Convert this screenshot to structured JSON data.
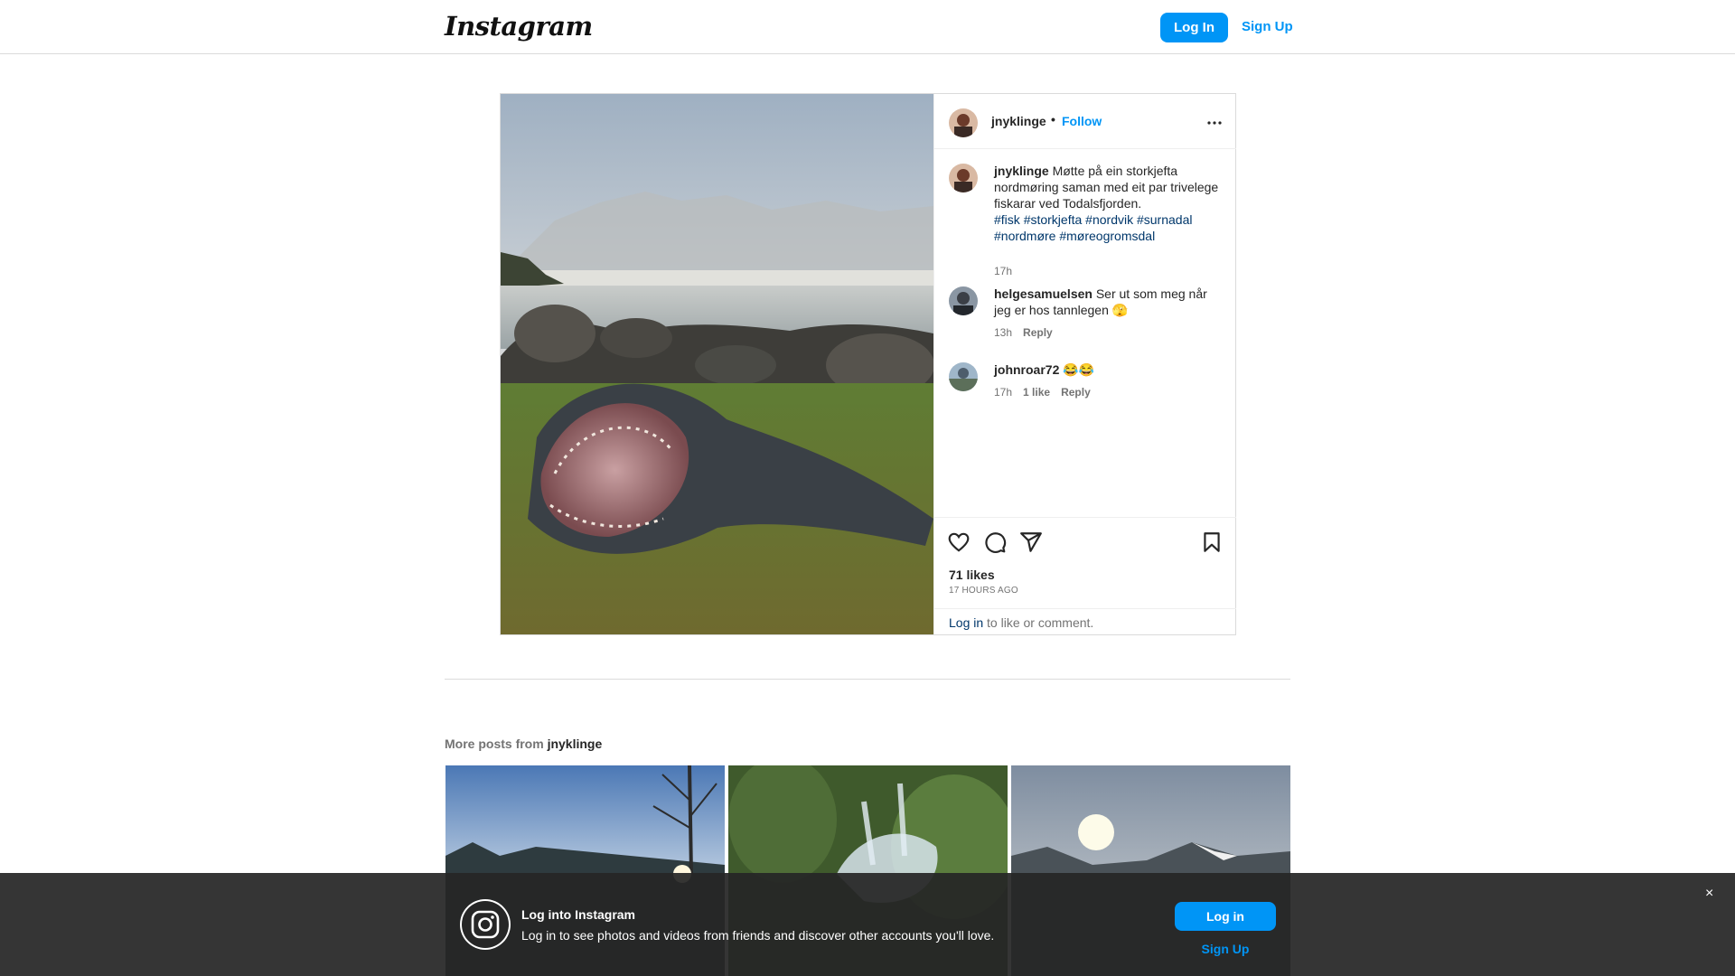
{
  "nav": {
    "logo": "Instagram",
    "login_label": "Log In",
    "signup_label": "Sign Up"
  },
  "post": {
    "username": "jnyklinge",
    "separator": "•",
    "follow_label": "Follow",
    "more_icon": "more-horizontal-icon",
    "caption": {
      "username": "jnyklinge",
      "text": "Møtte på ein storkjefta nordmøring saman med eit par trivelege fiskarar ved Todalsfjorden.",
      "hashtags": [
        "#fisk",
        "#storkjefta",
        "#nordvik",
        "#surnadal",
        "#nordmøre",
        "#møreogromsdal"
      ],
      "time": "17h"
    },
    "comments": [
      {
        "username": "helgesamuelsen",
        "text": "Ser ut som meg når jeg er hos tannlegen 🫣",
        "time": "13h",
        "likes": "",
        "reply_label": "Reply"
      },
      {
        "username": "johnroar72",
        "text": "😂😂",
        "time": "17h",
        "likes": "1 like",
        "reply_label": "Reply"
      }
    ],
    "likes": "71 likes",
    "time_ago": "17 HOURS AGO",
    "login_link": "Log in",
    "login_suffix": " to like or comment."
  },
  "more_posts": {
    "prefix": "More posts from ",
    "username": "jnyklinge"
  },
  "banner": {
    "title": "Log into Instagram",
    "text": "Log in to see photos and videos from friends and discover other accounts you'll love.",
    "login_label": "Log in",
    "signup_label": "Sign Up",
    "close": "×"
  },
  "colors": {
    "accent": "#0095f6",
    "hashtag": "#00376b",
    "muted": "#737373",
    "border": "#dbdbdb"
  }
}
